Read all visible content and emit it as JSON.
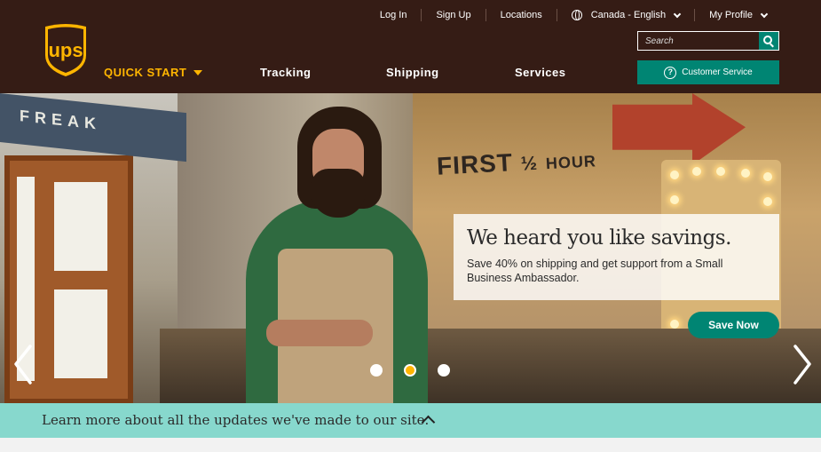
{
  "brand": {
    "logo_text": "ups",
    "colors": {
      "brown": "#351c15",
      "gold": "#ffb500",
      "teal": "#008573",
      "mint": "#87d8cd"
    }
  },
  "utility_nav": {
    "login": "Log In",
    "signup": "Sign Up",
    "locations": "Locations",
    "language": "Canada - English",
    "profile": "My Profile"
  },
  "search": {
    "placeholder": "Search",
    "icon": "search-icon"
  },
  "main_nav": {
    "quick_start": "QUICK START",
    "items": [
      "Tracking",
      "Shipping",
      "Services"
    ]
  },
  "customer_service": {
    "label": "Customer Service",
    "icon": "question-circle-icon"
  },
  "hero": {
    "sign_text": "FREAK",
    "first_half_hour": "FIRST",
    "half": "½",
    "hour": "HOUR",
    "promo_title": "We heard you like savings.",
    "promo_text": "Save 40% on shipping and get support from a Small Business Ambassador.",
    "cta": "Save Now",
    "carousel": {
      "slides": 3,
      "active": 2
    }
  },
  "notice": {
    "text": "Learn more about all the updates we've made to our site."
  }
}
